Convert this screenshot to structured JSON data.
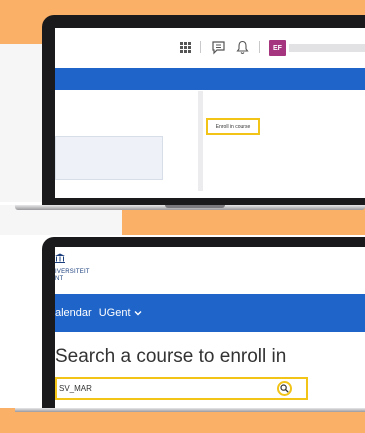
{
  "laptop_top": {
    "avatar_initials": "EF",
    "enroll_link": "Enroll in course"
  },
  "laptop_bottom": {
    "logo_line1": "IVERSITEIT",
    "logo_line2": "NT",
    "nav": {
      "calendar": "alendar",
      "ugent": "UGent"
    },
    "search_title": "Search a course to enroll in",
    "search_value": "SV_MAR"
  },
  "colors": {
    "accent_orange": "#fbb068",
    "nav_blue": "#1f64c8",
    "highlight_yellow": "#f2c418",
    "avatar_purple": "#a4357e"
  },
  "icons": [
    "grid-icon",
    "chat-icon",
    "bell-icon",
    "university-logo-icon",
    "chevron-down-icon",
    "search-icon"
  ]
}
